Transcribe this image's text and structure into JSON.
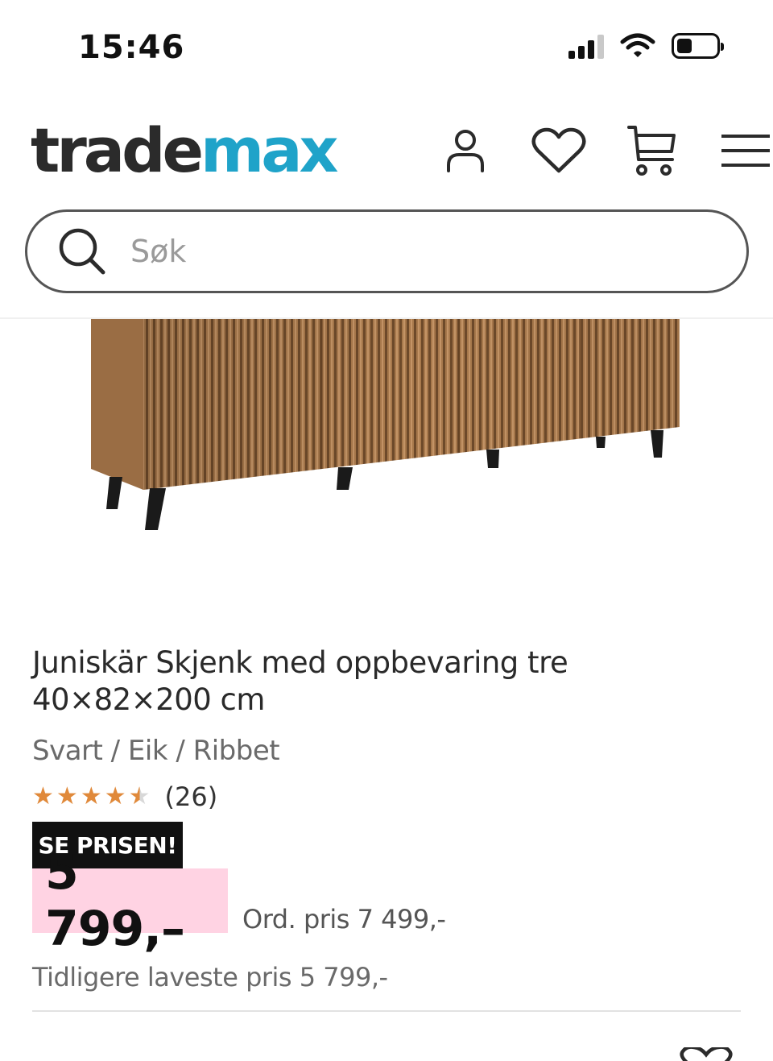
{
  "status_bar": {
    "time": "15:46",
    "battery_level": 0.35
  },
  "header": {
    "logo_part1": "trade",
    "logo_part2": "max",
    "logo_colors": {
      "dark": "#2b2b2b",
      "accent": "#1fa3c9"
    },
    "icons": [
      "user-icon",
      "heart-icon",
      "cart-icon",
      "menu-icon"
    ]
  },
  "search": {
    "placeholder": "Søk",
    "value": ""
  },
  "product": {
    "image": "ribbed-oak-sideboard",
    "title": "Juniskär Skjenk med oppbevaring tre 40×82×200 cm",
    "variant": "Svart / Eik / Ribbet",
    "rating_value": 4.5,
    "rating_count": "(26)",
    "badge": "SE PRISEN!",
    "price": "5 799,–",
    "ord_price": "Ord. pris 7 499,-",
    "lowest_price": "Tidligere laveste pris 5 799,-",
    "colors": {
      "star": "#e0893a",
      "price_bg": "#ffd3e3",
      "badge_bg": "#111111"
    }
  }
}
